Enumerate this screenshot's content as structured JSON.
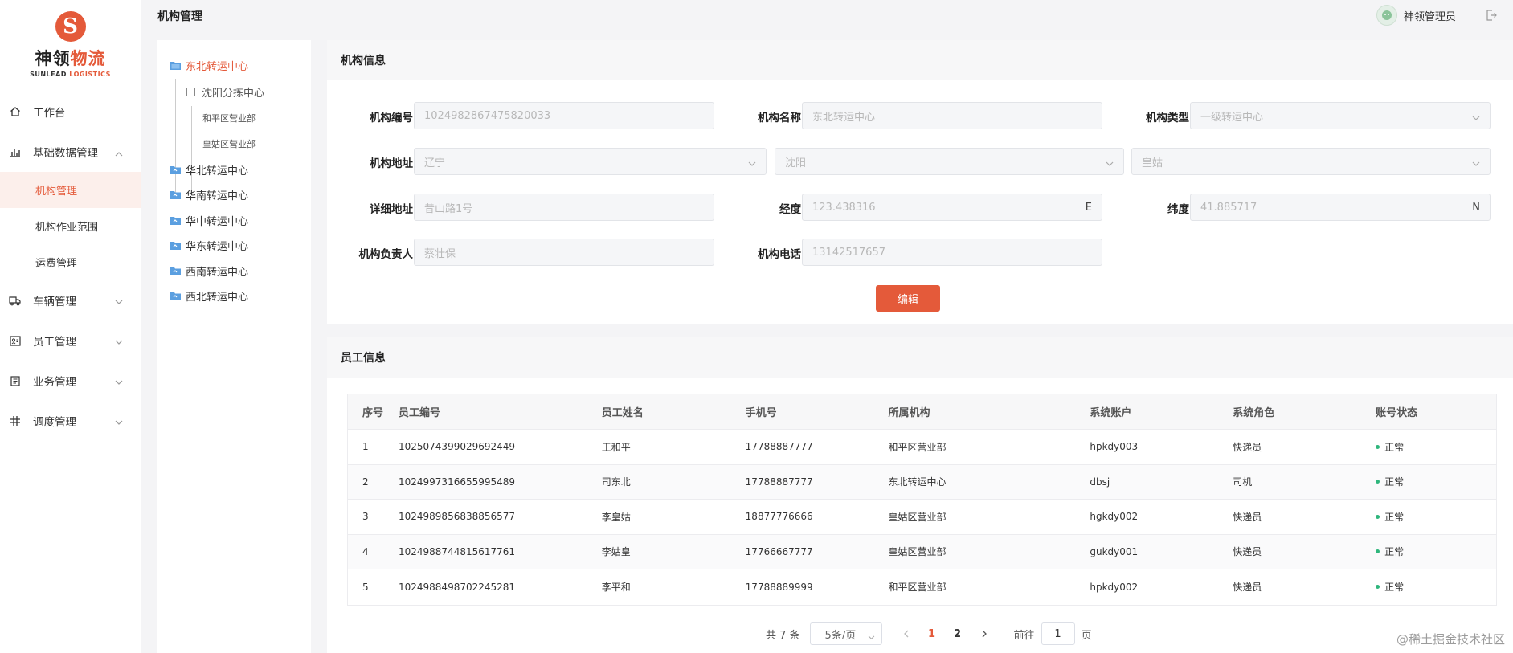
{
  "brand": {
    "mark": "S",
    "name_left": "神领",
    "name_right": "物流",
    "sub_left": "SUNLEAD",
    "sub_right": "LOGISTICS"
  },
  "header": {
    "title": "机构管理",
    "user_name": "神领管理员"
  },
  "sidebar": {
    "items": [
      {
        "label": "工作台",
        "icon": "home-icon"
      },
      {
        "label": "基础数据管理",
        "icon": "chart-icon",
        "expanded": true,
        "children": [
          {
            "label": "机构管理",
            "active": true
          },
          {
            "label": "机构作业范围"
          },
          {
            "label": "运费管理"
          }
        ]
      },
      {
        "label": "车辆管理",
        "icon": "truck-icon"
      },
      {
        "label": "员工管理",
        "icon": "id-card-icon"
      },
      {
        "label": "业务管理",
        "icon": "book-icon"
      },
      {
        "label": "调度管理",
        "icon": "hash-icon"
      }
    ]
  },
  "tree": {
    "root": "东北转运中心",
    "child": "沈阳分拣中心",
    "leaves": [
      "和平区营业部",
      "皇姑区营业部"
    ],
    "others": [
      "华北转运中心",
      "华南转运中心",
      "华中转运中心",
      "华东转运中心",
      "西南转运中心",
      "西北转运中心"
    ]
  },
  "org": {
    "section_title": "机构信息",
    "labels": {
      "code": "机构编号",
      "name": "机构名称",
      "type": "机构类型",
      "address": "机构地址",
      "detail": "详细地址",
      "lng": "经度",
      "lat": "纬度",
      "manager": "机构负责人",
      "phone": "机构电话"
    },
    "values": {
      "code": "1024982867475820033",
      "name": "东北转运中心",
      "type": "一级转运中心",
      "province": "辽宁",
      "city": "沈阳",
      "district": "皇姑",
      "detail": "昔山路1号",
      "lng": "123.438316",
      "lng_suffix": "E",
      "lat": "41.885717",
      "lat_suffix": "N",
      "manager": "蔡壮保",
      "phone": "13142517657"
    },
    "edit_label": "编辑"
  },
  "staff": {
    "section_title": "员工信息",
    "columns": [
      "序号",
      "员工编号",
      "员工姓名",
      "手机号",
      "所属机构",
      "系统账户",
      "系统角色",
      "账号状态"
    ],
    "rows": [
      [
        "1",
        "1025074399029692449",
        "王和平",
        "17788887777",
        "和平区营业部",
        "hpkdy003",
        "快递员",
        "正常"
      ],
      [
        "2",
        "1024997316655995489",
        "司东北",
        "17788887777",
        "东北转运中心",
        "dbsj",
        "司机",
        "正常"
      ],
      [
        "3",
        "1024989856838856577",
        "李皇姑",
        "18877776666",
        "皇姑区营业部",
        "hgkdy002",
        "快递员",
        "正常"
      ],
      [
        "4",
        "1024988744815617761",
        "李姑皇",
        "17766667777",
        "皇姑区营业部",
        "gukdy001",
        "快递员",
        "正常"
      ],
      [
        "5",
        "1024988498702245281",
        "李平和",
        "17788889999",
        "和平区营业部",
        "hpkdy002",
        "快递员",
        "正常"
      ]
    ]
  },
  "pager": {
    "total": "共 7 条",
    "size": "5条/页",
    "pages": [
      "1",
      "2"
    ],
    "goto": "前往",
    "current": "1",
    "unit": "页"
  },
  "watermark": "@稀土掘金技术社区",
  "colors": {
    "accent": "#e45a3a",
    "success": "#2fb67c"
  }
}
